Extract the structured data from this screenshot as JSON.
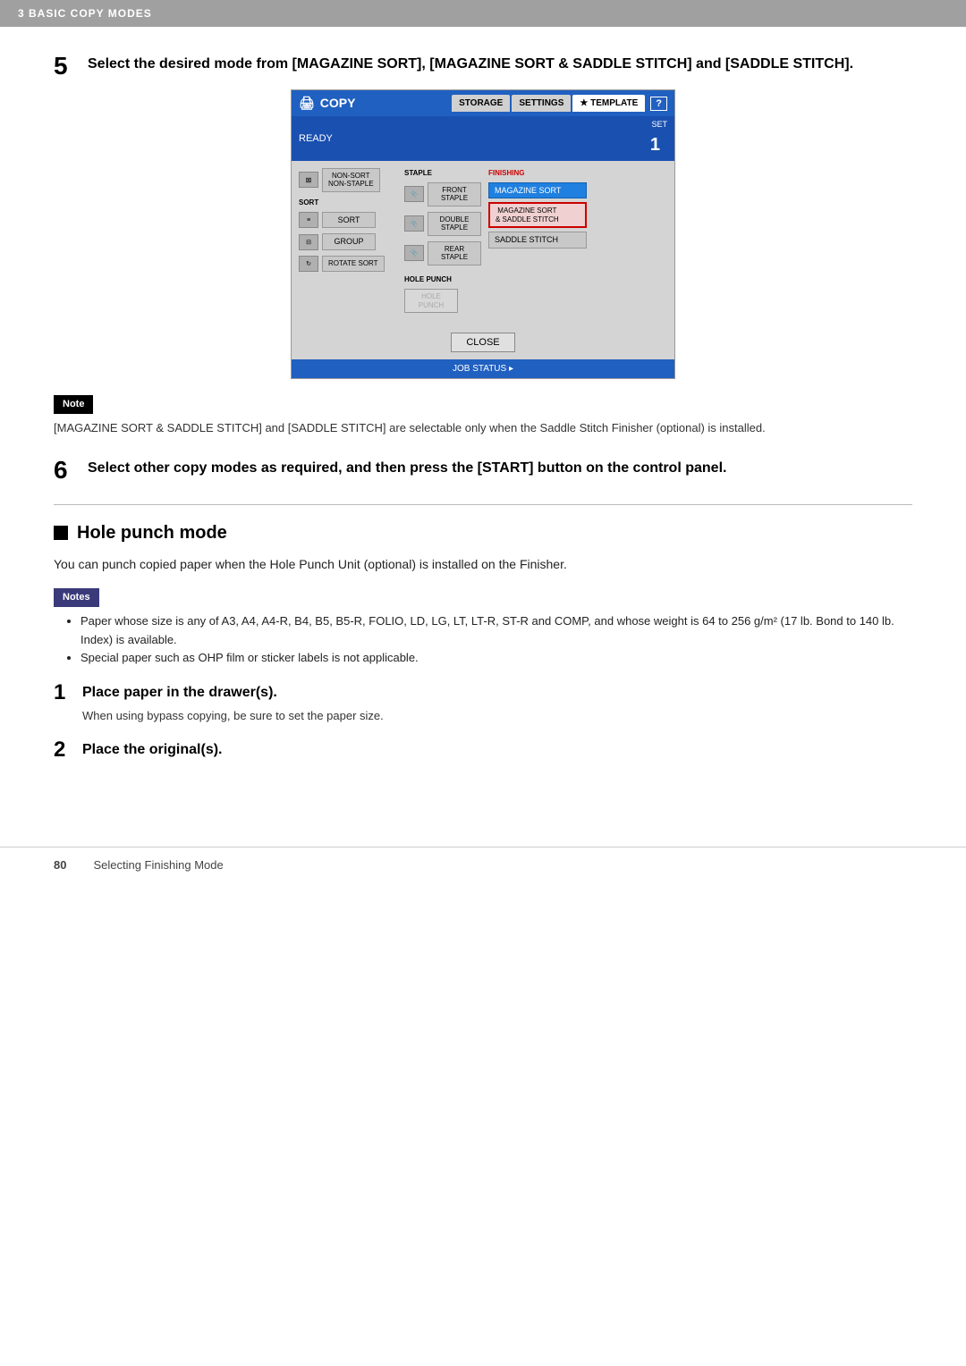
{
  "topBar": {
    "label": "3 BASIC COPY MODES"
  },
  "step5": {
    "number": "5",
    "heading": "Select the desired mode from [MAGAZINE SORT], [MAGAZINE SORT & SADDLE STITCH] and [SADDLE STITCH]."
  },
  "copyPanel": {
    "title": "COPY",
    "tabs": [
      "STORAGE",
      "SETTINGS",
      "★ TEMPLATE"
    ],
    "helpBtn": "?",
    "status": "READY",
    "setLabel": "SET",
    "setNum": "1",
    "stapleLabel": "STAPLE",
    "finishingLabel": "FINISHING",
    "holePunchLabel": "HOLE PUNCH",
    "buttons": {
      "nonSort": "NON-SORT\nNON-STAPLE",
      "sort": "SORT",
      "group": "GROUP",
      "rotateSort": "ROTATE SORT",
      "frontStaple": "FRONT\nSTAPLE",
      "doubleStaple": "DOUBLE\nSTAPLE",
      "rearStaple": "REAR\nSTAPLE",
      "holePunch": "HOLE\nPUNCH",
      "magazineSort": "MAGAZINE SORT",
      "magazineSortSaddle": "MAGAZINE SORT\n& SADDLE STITCH",
      "saddleStitch": "SADDLE STITCH"
    },
    "closeBtn": "CLOSE",
    "jobStatusBtn": "JOB STATUS ▸"
  },
  "note5": {
    "label": "Note",
    "text": "[MAGAZINE SORT & SADDLE STITCH] and [SADDLE STITCH] are selectable only when the Saddle Stitch Finisher (optional) is installed."
  },
  "step6": {
    "number": "6",
    "heading": "Select other copy modes as required, and then press the [START] button on the control panel."
  },
  "holePunchSection": {
    "squareSymbol": "■",
    "heading": "Hole punch mode",
    "description": "You can punch copied paper when the Hole Punch Unit (optional) is installed on the Finisher."
  },
  "notesBox": {
    "label": "Notes",
    "items": [
      "Paper whose size is any of A3, A4, A4-R, B4, B5, B5-R, FOLIO, LD, LG, LT, LT-R, ST-R and COMP, and whose weight is 64 to 256 g/m² (17 lb. Bond to 140 lb. Index) is available.",
      "Special paper such as OHP film or sticker labels is not applicable."
    ]
  },
  "subStep1": {
    "number": "1",
    "heading": "Place paper in the drawer(s).",
    "description": "When using bypass copying, be sure to set the paper size."
  },
  "subStep2": {
    "number": "2",
    "heading": "Place the original(s)."
  },
  "footer": {
    "pageNum": "80",
    "pageLabel": "Selecting Finishing Mode"
  }
}
